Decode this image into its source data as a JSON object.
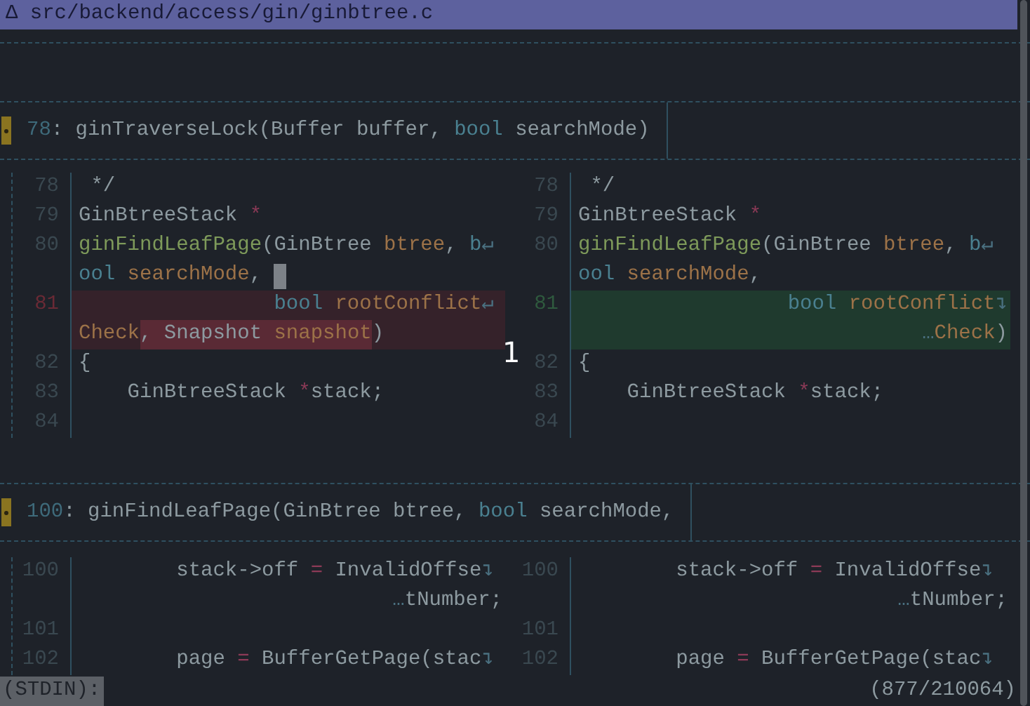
{
  "file_header": {
    "icon": "Δ",
    "path": "src/backend/access/gin/ginbtree.c"
  },
  "hunks": [
    {
      "header": {
        "line": "78",
        "segments": [
          {
            "kind": "plain",
            "text": ": ginTraverseLock(Buffer buffer, "
          },
          {
            "kind": "kw",
            "text": "bool"
          },
          {
            "kind": "plain",
            "text": " searchMode)"
          }
        ]
      },
      "left": [
        {
          "num": "78",
          "kind": "context",
          "right_aligned": false,
          "cursor": false,
          "segments": [
            {
              "kind": "plain",
              "text": " */"
            }
          ]
        },
        {
          "num": "79",
          "kind": "context",
          "right_aligned": false,
          "cursor": false,
          "segments": [
            {
              "kind": "plain",
              "text": "GinBtreeStack "
            },
            {
              "kind": "op",
              "text": "*"
            }
          ]
        },
        {
          "num": "80",
          "kind": "context",
          "right_aligned": false,
          "cursor": false,
          "segments": [
            {
              "kind": "fn",
              "text": "ginFindLeafPage"
            },
            {
              "kind": "plain",
              "text": "(GinBtree "
            },
            {
              "kind": "param",
              "text": "btree"
            },
            {
              "kind": "plain",
              "text": ", "
            },
            {
              "kind": "kw",
              "text": "b"
            },
            {
              "kind": "mark",
              "text": "↵"
            }
          ]
        },
        {
          "kind": "context",
          "right_aligned": false,
          "cursor": true,
          "segments": [
            {
              "kind": "kw",
              "text": "ool"
            },
            {
              "kind": "param",
              "text": " searchMode"
            },
            {
              "kind": "plain",
              "text": ", "
            }
          ]
        },
        {
          "num": "81",
          "kind": "minus",
          "right_aligned": false,
          "cursor": false,
          "segments": [
            {
              "kind": "kw",
              "text": "                bool"
            },
            {
              "kind": "param",
              "text": " rootConflict"
            },
            {
              "kind": "mark",
              "text": "↵"
            }
          ]
        },
        {
          "kind": "minus",
          "right_aligned": false,
          "cursor": false,
          "segments": [
            {
              "kind": "param",
              "text": "Check"
            },
            {
              "kind": "changed",
              "text": ", Snapshot "
            },
            {
              "kind": "changed_param",
              "text": "snapshot"
            },
            {
              "kind": "plain",
              "text": ")"
            }
          ]
        },
        {
          "num": "82",
          "kind": "context",
          "right_aligned": false,
          "cursor": false,
          "segments": [
            {
              "kind": "plain",
              "text": "{"
            }
          ]
        },
        {
          "num": "83",
          "kind": "context",
          "right_aligned": false,
          "cursor": false,
          "segments": [
            {
              "kind": "plain",
              "text": "    GinBtreeStack "
            },
            {
              "kind": "op",
              "text": "*"
            },
            {
              "kind": "plain",
              "text": "stack;"
            }
          ]
        },
        {
          "num": "84",
          "kind": "context",
          "cursor": false
        }
      ],
      "right": [
        {
          "num": "78",
          "kind": "context",
          "right_aligned": false,
          "cursor": false,
          "segments": [
            {
              "kind": "plain",
              "text": " */"
            }
          ]
        },
        {
          "num": "79",
          "kind": "context",
          "right_aligned": false,
          "cursor": false,
          "segments": [
            {
              "kind": "plain",
              "text": "GinBtreeStack "
            },
            {
              "kind": "op",
              "text": "*"
            }
          ]
        },
        {
          "num": "80",
          "kind": "context",
          "right_aligned": false,
          "cursor": false,
          "segments": [
            {
              "kind": "fn",
              "text": "ginFindLeafPage"
            },
            {
              "kind": "plain",
              "text": "(GinBtree "
            },
            {
              "kind": "param",
              "text": "btree"
            },
            {
              "kind": "plain",
              "text": ", "
            },
            {
              "kind": "kw",
              "text": "b"
            },
            {
              "kind": "mark",
              "text": "↵"
            }
          ]
        },
        {
          "kind": "context",
          "right_aligned": false,
          "cursor": false,
          "segments": [
            {
              "kind": "kw",
              "text": "ool"
            },
            {
              "kind": "param",
              "text": " searchMode"
            },
            {
              "kind": "plain",
              "text": ","
            }
          ]
        },
        {
          "num": "81",
          "kind": "plus",
          "right_aligned": true,
          "cursor": false,
          "segments": [
            {
              "kind": "kw",
              "text": "bool"
            },
            {
              "kind": "param",
              "text": " rootConflict"
            },
            {
              "kind": "mark",
              "text": "↴"
            }
          ]
        },
        {
          "kind": "plus",
          "right_aligned": true,
          "cursor": false,
          "segments": [
            {
              "kind": "mark",
              "text": "…"
            },
            {
              "kind": "param",
              "text": "Check"
            },
            {
              "kind": "plain",
              "text": ")"
            }
          ]
        },
        {
          "num": "82",
          "kind": "context",
          "right_aligned": false,
          "cursor": false,
          "segments": [
            {
              "kind": "plain",
              "text": "{"
            }
          ]
        },
        {
          "num": "83",
          "kind": "context",
          "right_aligned": false,
          "cursor": false,
          "segments": [
            {
              "kind": "plain",
              "text": "    GinBtreeStack "
            },
            {
              "kind": "op",
              "text": "*"
            },
            {
              "kind": "plain",
              "text": "stack;"
            }
          ]
        },
        {
          "num": "84",
          "kind": "context",
          "cursor": false
        }
      ]
    },
    {
      "header": {
        "line": "100",
        "segments": [
          {
            "kind": "plain",
            "text": ": ginFindLeafPage(GinBtree btree, "
          },
          {
            "kind": "kw",
            "text": "bool"
          },
          {
            "kind": "plain",
            "text": " searchMode,"
          }
        ]
      },
      "left": [
        {
          "num": "100",
          "kind": "context",
          "right_aligned": false,
          "cursor": false,
          "segments": [
            {
              "kind": "plain",
              "text": "        stack->off "
            },
            {
              "kind": "op",
              "text": "="
            },
            {
              "kind": "plain",
              "text": " InvalidOffse"
            },
            {
              "kind": "mark",
              "text": "↴"
            }
          ]
        },
        {
          "kind": "context",
          "right_aligned": true,
          "cursor": false,
          "segments": [
            {
              "kind": "mark",
              "text": "…"
            },
            {
              "kind": "plain",
              "text": "tNumber;"
            }
          ]
        },
        {
          "num": "101",
          "kind": "context",
          "cursor": false
        },
        {
          "num": "102",
          "kind": "context",
          "right_aligned": false,
          "cursor": false,
          "segments": [
            {
              "kind": "plain",
              "text": "        page "
            },
            {
              "kind": "op",
              "text": "="
            },
            {
              "kind": "plain",
              "text": " BufferGetPage(stac"
            },
            {
              "kind": "mark",
              "text": "↴"
            }
          ]
        }
      ],
      "right": [
        {
          "num": "100",
          "kind": "context",
          "right_aligned": false,
          "cursor": false,
          "segments": [
            {
              "kind": "plain",
              "text": "        stack->off "
            },
            {
              "kind": "op",
              "text": "="
            },
            {
              "kind": "plain",
              "text": " InvalidOffse"
            },
            {
              "kind": "mark",
              "text": "↴"
            }
          ]
        },
        {
          "kind": "context",
          "right_aligned": true,
          "cursor": false,
          "segments": [
            {
              "kind": "mark",
              "text": "…"
            },
            {
              "kind": "plain",
              "text": "tNumber;"
            }
          ]
        },
        {
          "num": "101",
          "kind": "context",
          "cursor": false
        },
        {
          "num": "102",
          "kind": "context",
          "right_aligned": false,
          "cursor": false,
          "segments": [
            {
              "kind": "plain",
              "text": "        page "
            },
            {
              "kind": "op",
              "text": "="
            },
            {
              "kind": "plain",
              "text": " BufferGetPage(stac"
            },
            {
              "kind": "mark",
              "text": "↴"
            }
          ]
        }
      ]
    }
  ],
  "overlay_number": "1",
  "status_bar": {
    "prompt": "(STDIN):",
    "position": "(877/210064)"
  }
}
